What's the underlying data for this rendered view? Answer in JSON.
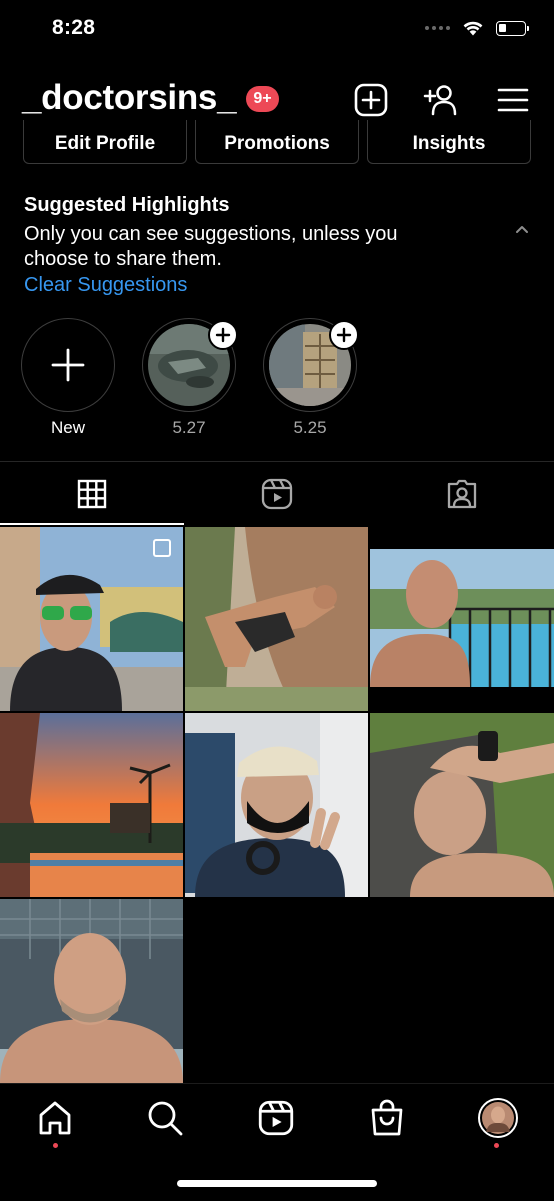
{
  "status_bar": {
    "time": "8:28"
  },
  "header": {
    "username": "_doctorsins_",
    "notification_badge": "9+",
    "icons": [
      "new-post-icon",
      "add-person-icon",
      "menu-icon"
    ]
  },
  "profile_buttons": [
    {
      "label": "Edit Profile"
    },
    {
      "label": "Promotions"
    },
    {
      "label": "Insights"
    }
  ],
  "suggested_highlights": {
    "title": "Suggested Highlights",
    "description": "Only you can see suggestions, unless you choose to share them.",
    "clear_label": "Clear Suggestions"
  },
  "highlights": [
    {
      "label": "New"
    },
    {
      "label": "5.27"
    },
    {
      "label": "5.25"
    }
  ],
  "tabs": [
    {
      "name": "grid-tab",
      "icon": "grid-icon",
      "active": true
    },
    {
      "name": "reels-tab",
      "icon": "reels-icon",
      "active": false
    },
    {
      "name": "tagged-tab",
      "icon": "tagged-person-icon",
      "active": false
    }
  ],
  "grid_posts": [
    {
      "description": "man in black cap and sunglasses in plaza",
      "multi": true
    },
    {
      "description": "man in yoga arm balance on rocks"
    },
    {
      "description": "shirtless selfie by pool railing"
    },
    {
      "description": "sunset over pool with palm trees"
    },
    {
      "description": "man in mask on airplane peace sign"
    },
    {
      "description": "man lying on mat hand on head"
    },
    {
      "description": "man in hot tub selfie"
    }
  ],
  "bottom_nav": {
    "items": [
      "home-icon",
      "search-icon",
      "reels-icon",
      "shop-icon",
      "profile-avatar"
    ],
    "dots": [
      "home",
      "profile"
    ]
  },
  "colors": {
    "background": "#000000",
    "accent_link": "#3797f0",
    "badge": "#ed4956"
  }
}
